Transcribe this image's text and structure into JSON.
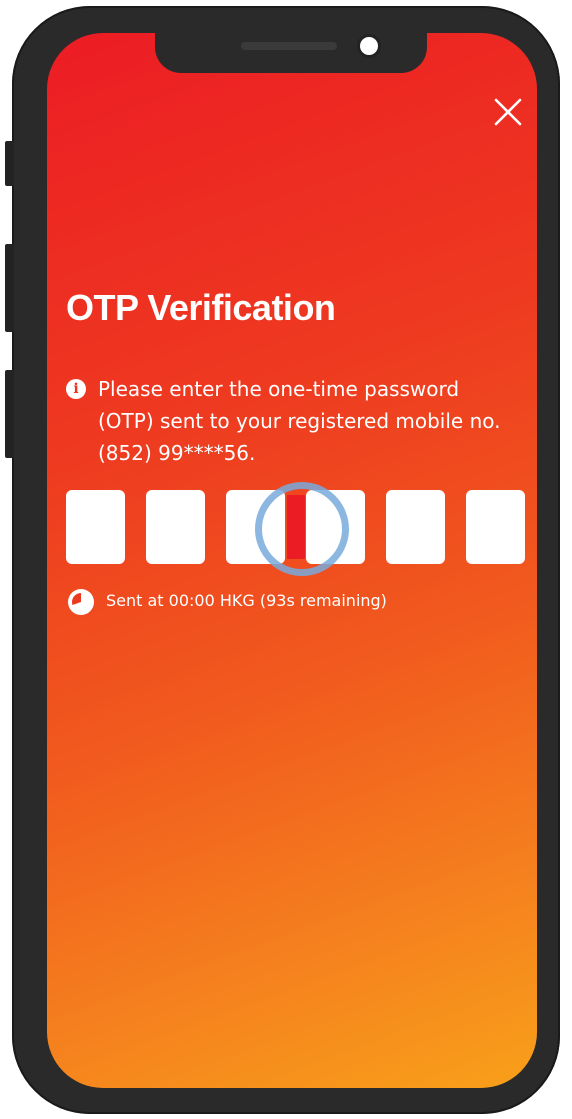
{
  "screen": {
    "title": "OTP Verification",
    "info_text": "Please enter the one-time password (OTP) sent to your registered mobile no. (852) 99****56.",
    "info_icon": "i",
    "timer_text": "Sent at 00:00 HKG (93s remaining)"
  },
  "otp": {
    "digits": [
      "",
      "",
      "",
      "",
      "",
      ""
    ]
  },
  "colors": {
    "accent": "#ec1c24",
    "gradient_end": "#f8a01a",
    "text": "#ffffff"
  },
  "icons": {
    "close": "close-icon",
    "info": "info-icon",
    "clock": "clock-icon"
  }
}
